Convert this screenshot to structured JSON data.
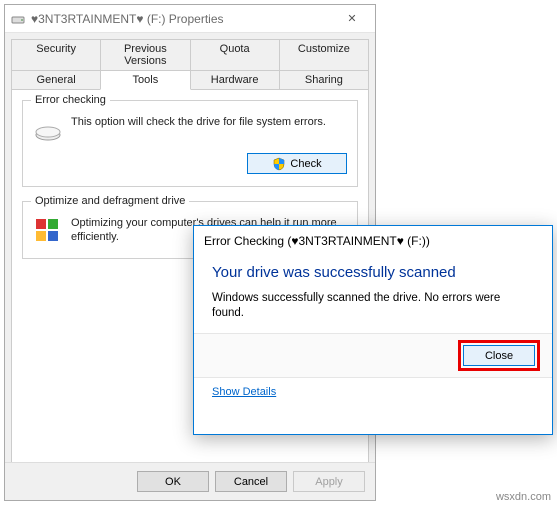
{
  "window": {
    "title": "♥3NT3RTAINMENT♥ (F:) Properties",
    "close_label": "✕"
  },
  "tabs_row1": [
    {
      "label": "Security"
    },
    {
      "label": "Previous Versions"
    },
    {
      "label": "Quota"
    },
    {
      "label": "Customize"
    }
  ],
  "tabs_row2": [
    {
      "label": "General"
    },
    {
      "label": "Tools",
      "active": true
    },
    {
      "label": "Hardware"
    },
    {
      "label": "Sharing"
    }
  ],
  "error_checking": {
    "legend": "Error checking",
    "desc": "This option will check the drive for file system errors.",
    "button": "Check"
  },
  "defrag": {
    "legend": "Optimize and defragment drive",
    "desc": "Optimizing your computer's drives can help it run more efficiently."
  },
  "buttons": {
    "ok": "OK",
    "cancel": "Cancel",
    "apply": "Apply"
  },
  "dialog": {
    "title": "Error Checking (♥3NT3RTAINMENT♥ (F:))",
    "heading": "Your drive was successfully scanned",
    "message": "Windows successfully scanned the drive. No errors were found.",
    "close": "Close",
    "show_details": "Show Details"
  },
  "watermark": "wsxdn.com"
}
